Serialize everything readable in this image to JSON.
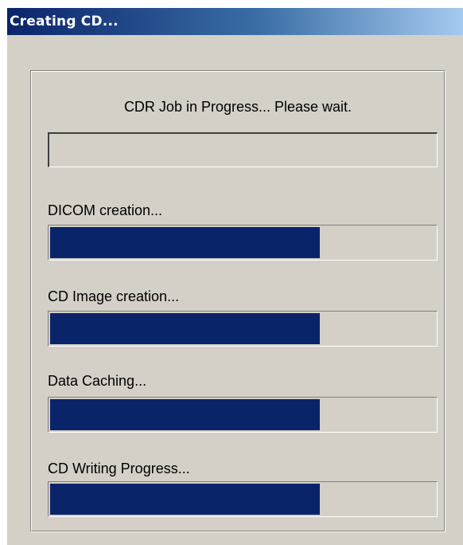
{
  "window": {
    "title": "Creating CD..."
  },
  "job": {
    "status_text": "CDR Job in Progress... Please wait.",
    "overall_progress": 0
  },
  "stages": [
    {
      "label": "DICOM creation...",
      "progress": 0.7
    },
    {
      "label": "CD Image creation...",
      "progress": 0.7
    },
    {
      "label": "Data Caching...",
      "progress": 0.7
    },
    {
      "label": "CD Writing Progress...",
      "progress": 0.7
    }
  ],
  "colors": {
    "progress_fill": "#0a246a",
    "dialog_face": "#d4d0c8",
    "titlebar_start": "#0a246a",
    "titlebar_end": "#a6caf0"
  }
}
